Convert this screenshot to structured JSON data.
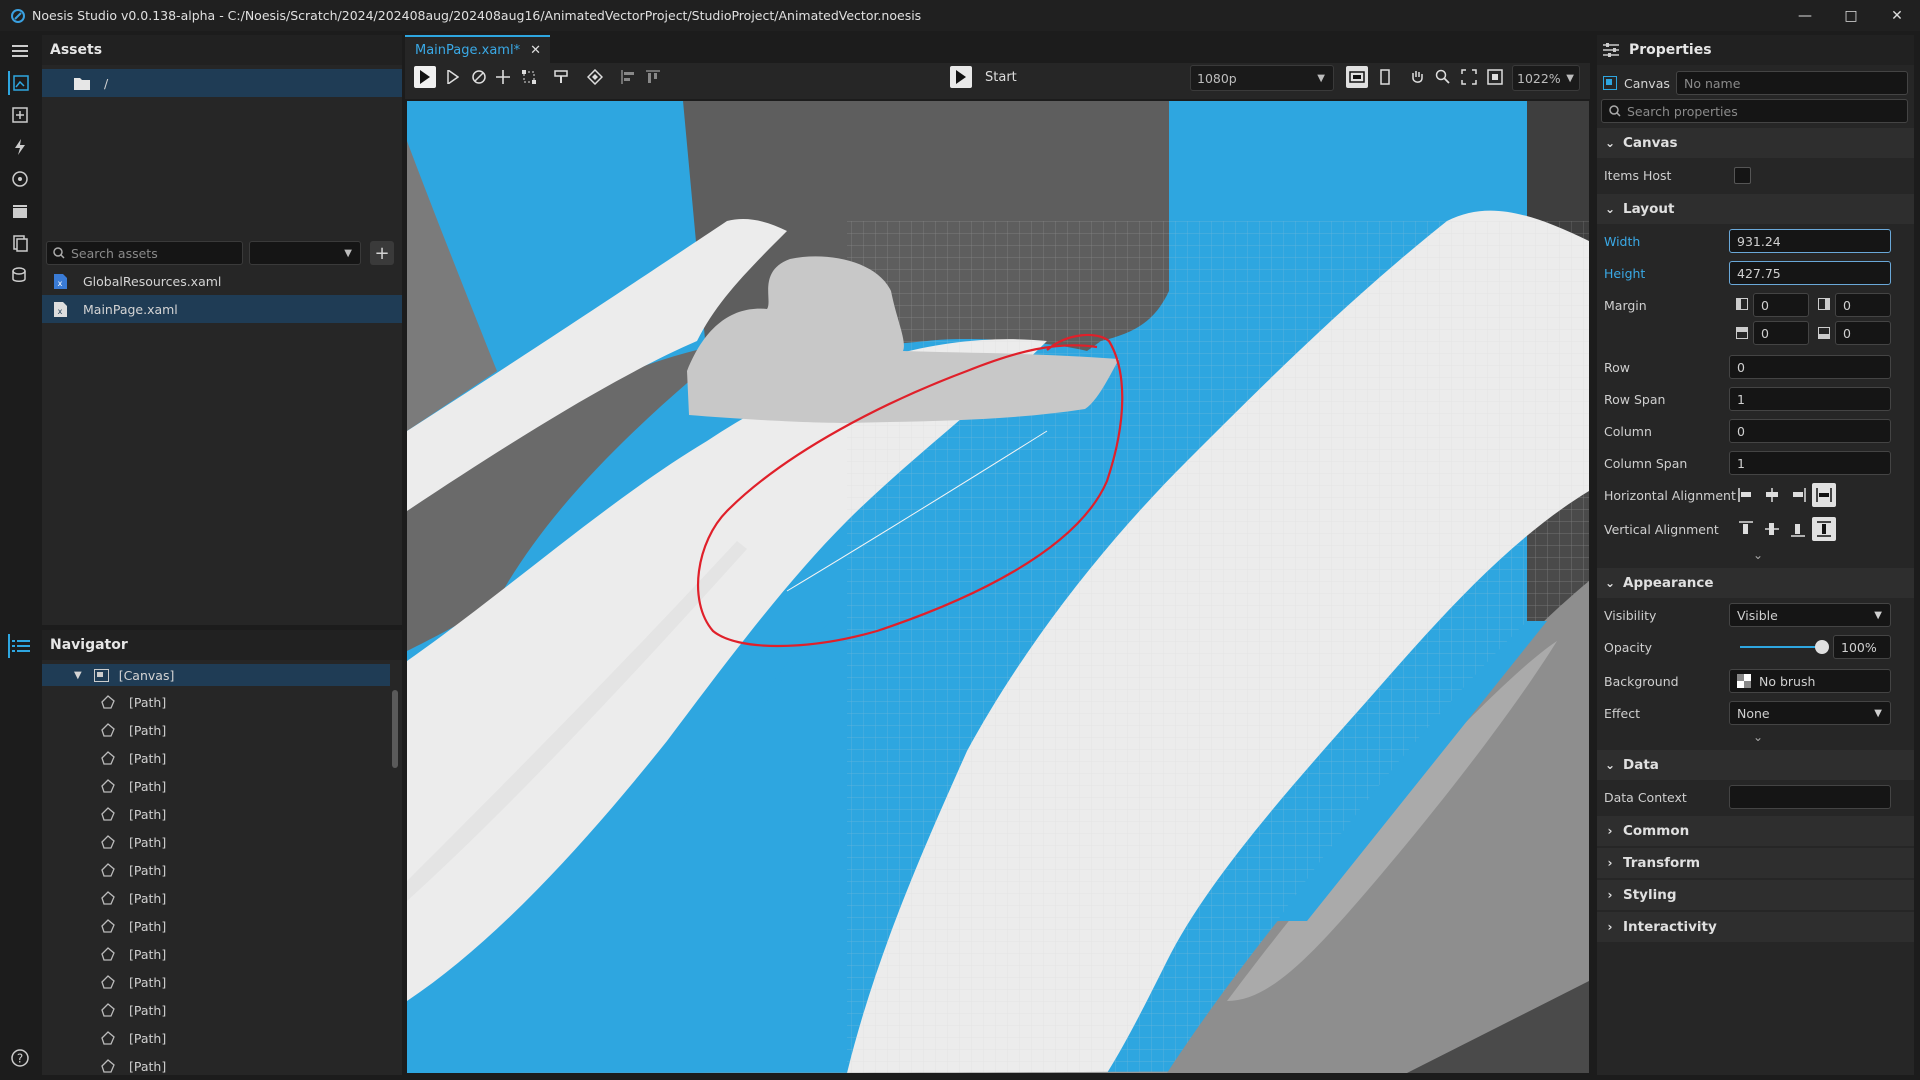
{
  "title": "Noesis Studio v0.0.138-alpha - C:/Noesis/Scratch/2024/202408aug/202408aug16/AnimatedVectorProject/StudioProject/AnimatedVector.noesis",
  "assets": {
    "header": "Assets",
    "folder": "/",
    "search_placeholder": "Search assets",
    "files": [
      "GlobalResources.xaml",
      "MainPage.xaml"
    ]
  },
  "navigator": {
    "header": "Navigator",
    "root": "[Canvas]",
    "items": [
      "[Path]",
      "[Path]",
      "[Path]",
      "[Path]",
      "[Path]",
      "[Path]",
      "[Path]",
      "[Path]",
      "[Path]",
      "[Path]",
      "[Path]",
      "[Path]",
      "[Path]",
      "[Path]"
    ]
  },
  "editor": {
    "tab": "MainPage.xaml*",
    "start_label": "Start",
    "resolution": "1080p",
    "zoom": "1022%"
  },
  "properties": {
    "header": "Properties",
    "element_type": "Canvas",
    "name_placeholder": "No name",
    "search_placeholder": "Search properties",
    "canvas_section": "Canvas",
    "items_host_label": "Items Host",
    "layout_section": "Layout",
    "width_label": "Width",
    "width_value": "931.24",
    "height_label": "Height",
    "height_value": "427.75",
    "margin_label": "Margin",
    "margin_left": "0",
    "margin_right": "0",
    "margin_top": "0",
    "margin_bottom": "0",
    "row_label": "Row",
    "row_value": "0",
    "rowspan_label": "Row Span",
    "rowspan_value": "1",
    "column_label": "Column",
    "column_value": "0",
    "colspan_label": "Column Span",
    "colspan_value": "1",
    "halign_label": "Horizontal Alignment",
    "valign_label": "Vertical Alignment",
    "appearance_section": "Appearance",
    "visibility_label": "Visibility",
    "visibility_value": "Visible",
    "opacity_label": "Opacity",
    "opacity_value": "100%",
    "opacity_level": 1.0,
    "background_label": "Background",
    "background_value": "No brush",
    "effect_label": "Effect",
    "effect_value": "None",
    "data_section": "Data",
    "datacontext_label": "Data Context",
    "collapsed_sections": [
      "Common",
      "Transform",
      "Styling",
      "Interactivity"
    ]
  },
  "colors": {
    "accent": "#2ea6e0",
    "annotation": "#e0202a",
    "selection": "#1f3c55"
  }
}
